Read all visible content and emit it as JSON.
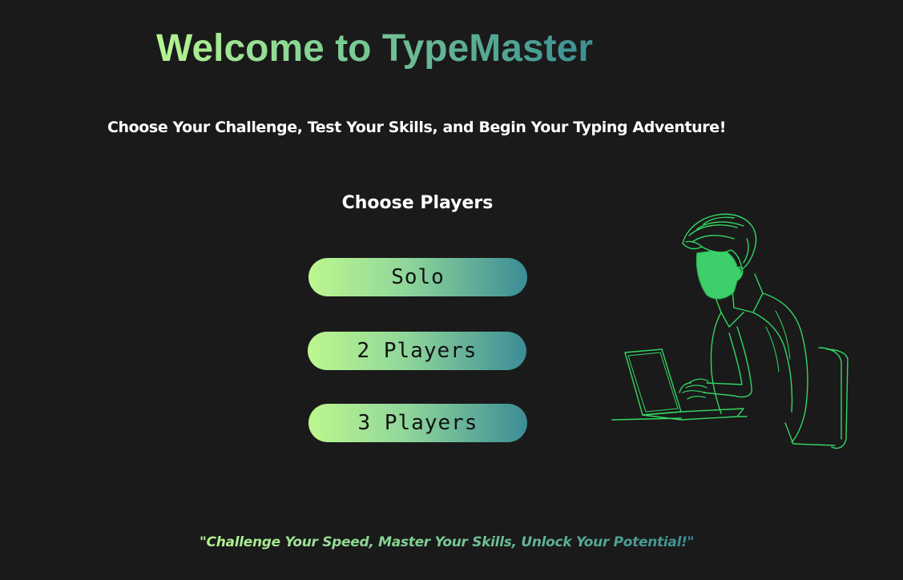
{
  "header": {
    "title": "Welcome to TypeMaster",
    "subtitle": "Choose Your Challenge, Test Your Skills, and Begin Your Typing Adventure!"
  },
  "players": {
    "heading": "Choose Players",
    "options": [
      {
        "label": "Solo"
      },
      {
        "label": "2 Players"
      },
      {
        "label": "3 Players"
      }
    ]
  },
  "illustration": {
    "icon": "person-typing-on-laptop-illustration"
  },
  "footer": {
    "quote": "\"Challenge Your Speed, Master Your Skills, Unlock Your Potential!\""
  },
  "colors": {
    "background": "#1a1a1a",
    "gradient_start": "#b6f591",
    "gradient_end": "#3b8f93",
    "illustration_stroke": "#34d663"
  }
}
